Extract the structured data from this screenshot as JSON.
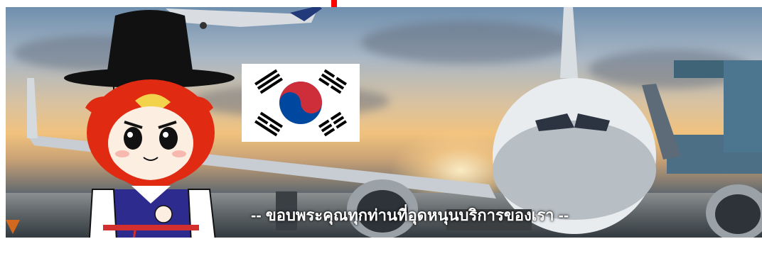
{
  "banner": {
    "caption": "-- ขอบพระคุณทุกท่านที่อุดหนุนบริการของเรา --"
  },
  "flag": {
    "name": "South Korea",
    "colors": {
      "red": "#cd2e3a",
      "blue": "#0047a0",
      "black": "#000000",
      "white": "#ffffff"
    }
  },
  "mascot": {
    "colors": {
      "hat": "#111111",
      "hair": "#e02a12",
      "robe": "#2e2b8f",
      "sash": "#d32f2f"
    }
  },
  "icons": [
    "korean-flag-icon",
    "mascot-illustration",
    "airplane-illustration"
  ]
}
